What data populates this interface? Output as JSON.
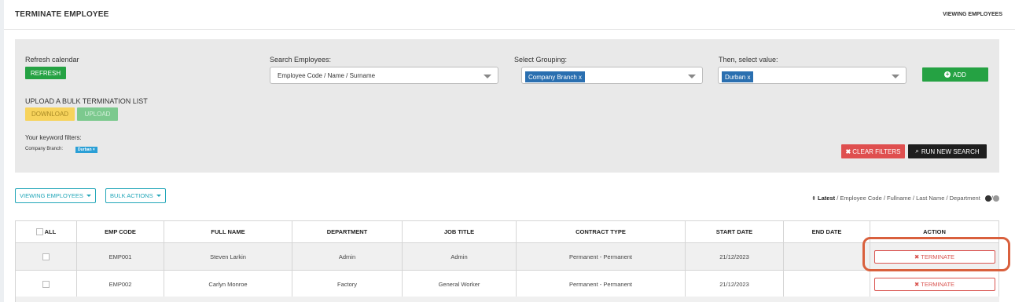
{
  "header": {
    "title": "TERMINATE EMPLOYEE",
    "right_label": "VIEWING EMPLOYEES"
  },
  "filters": {
    "refresh_label": "Refresh calendar",
    "refresh_button": "REFRESH",
    "search_label": "Search Employees:",
    "search_value": "Employee Code / Name / Surname",
    "grouping_label": "Select Grouping:",
    "grouping_tag": "Company Branch x",
    "value_label": "Then, select value:",
    "value_tag": "Durban x",
    "add_button": "ADD",
    "bulk_label": "UPLOAD A BULK TERMINATION LIST",
    "download_button": "DOWNLOAD",
    "upload_button": "UPLOAD",
    "keyword_label": "Your keyword filters:",
    "keyword_key": "Company Branch:",
    "keyword_tag": "Durban ×",
    "clear_button": "CLEAR FILTERS",
    "run_button": "RUN NEW SEARCH"
  },
  "toolbar": {
    "viewing_button": "VIEWING EMPLOYEES",
    "bulk_button": "BULK ACTIONS",
    "sort_active": "Latest",
    "sort_rest": "/ Employee Code / Fullname / Last Name / Department"
  },
  "table": {
    "columns": [
      "ALL",
      "EMP CODE",
      "FULL NAME",
      "DEPARTMENT",
      "JOB TITLE",
      "CONTRACT TYPE",
      "START DATE",
      "END DATE",
      "ACTION"
    ],
    "rows": [
      {
        "code": "EMP001",
        "name": "Steven Larkin",
        "department": "Admin",
        "job": "Admin",
        "contract": "Permanent - Permanent",
        "start": "21/12/2023",
        "end": "",
        "action": "TERMINATE"
      },
      {
        "code": "EMP002",
        "name": "Carlyn Monroe",
        "department": "Factory",
        "job": "General Worker",
        "contract": "Permanent - Permanent",
        "start": "21/12/2023",
        "end": "",
        "action": "TERMINATE"
      }
    ]
  },
  "colors": {
    "accent_green": "#25a243",
    "tag_blue": "#2a6fb0",
    "danger_red": "#d9534f",
    "teal": "#21a6b8",
    "highlight": "#d9603d"
  }
}
